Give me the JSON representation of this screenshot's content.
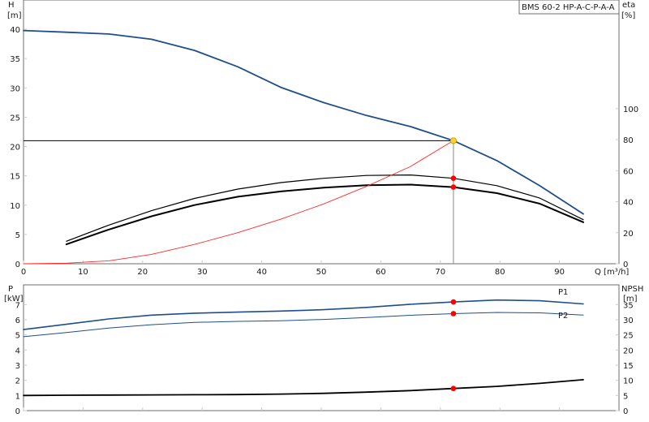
{
  "model_label": "BMS 60-2 HP-A-C-P-A-A",
  "colors": {
    "h_curve": "#1f4e8c",
    "p_curves": "#1f4e8c",
    "eta_curves": "#000000",
    "system_curve": "#ff2a2a",
    "duty_point": "#ffd42a",
    "markers": "#ff0000",
    "duty_line": "#000000",
    "duty_vertical": "#888888"
  },
  "chart_data": [
    {
      "id": "head_efficiency",
      "type": "line",
      "xlabel": "Q [m³/h]",
      "ylabel_left_name": "H",
      "ylabel_left_unit": "[m]",
      "ylabel_right_name": "eta",
      "ylabel_right_unit": "[%]",
      "xlim": [
        0,
        100
      ],
      "ylim_left": [
        0,
        45
      ],
      "ylim_right": [
        0,
        170
      ],
      "xticks": [
        0,
        10,
        20,
        30,
        40,
        50,
        60,
        70,
        80,
        90
      ],
      "yticks_left": [
        0,
        5,
        10,
        15,
        20,
        25,
        30,
        35,
        40
      ],
      "yticks_right": [
        0,
        20,
        40,
        60,
        80,
        100
      ],
      "grid": false,
      "series": [
        {
          "key": "H",
          "axis": "left",
          "color": "#1f4e8c",
          "width": 1.8,
          "points": [
            [
              0,
              39.8
            ],
            [
              7.2,
              39.5
            ],
            [
              14.3,
              39.2
            ],
            [
              21.5,
              38.3
            ],
            [
              28.7,
              36.4
            ],
            [
              36,
              33.6
            ],
            [
              43.2,
              30.1
            ],
            [
              50.4,
              27.5
            ],
            [
              57.6,
              25.3
            ],
            [
              65,
              23.4
            ],
            [
              72.2,
              21.0
            ],
            [
              79.5,
              17.6
            ],
            [
              86.7,
              13.3
            ],
            [
              94,
              8.5
            ]
          ]
        },
        {
          "key": "eta_upper",
          "axis": "right",
          "color": "#000000",
          "width": 1.2,
          "points": [
            [
              7.2,
              14.5
            ],
            [
              14.3,
              24.9
            ],
            [
              21.5,
              34.2
            ],
            [
              28.7,
              42.1
            ],
            [
              36,
              48.1
            ],
            [
              43.2,
              52.3
            ],
            [
              50.4,
              55.1
            ],
            [
              57.6,
              56.9
            ],
            [
              65,
              57.2
            ],
            [
              72.2,
              55.1
            ],
            [
              79.5,
              50.3
            ],
            [
              86.7,
              42.3
            ],
            [
              94,
              28.4
            ]
          ]
        },
        {
          "key": "eta_lower",
          "axis": "right",
          "color": "#000000",
          "width": 2,
          "points": [
            [
              7.2,
              12.5
            ],
            [
              14.3,
              22.0
            ],
            [
              21.5,
              30.6
            ],
            [
              28.7,
              37.8
            ],
            [
              36,
              43.2
            ],
            [
              43.2,
              46.6
            ],
            [
              50.4,
              49.0
            ],
            [
              57.6,
              50.6
            ],
            [
              65,
              51.0
            ],
            [
              72.2,
              49.4
            ],
            [
              79.5,
              45.5
            ],
            [
              86.7,
              38.7
            ],
            [
              94,
              26.8
            ]
          ]
        },
        {
          "key": "system_curve",
          "axis": "left",
          "color": "#ff2a2a",
          "width": 0.9,
          "points": [
            [
              0,
              0
            ],
            [
              7.2,
              0.1
            ],
            [
              14.3,
              0.5
            ],
            [
              21.5,
              1.6
            ],
            [
              28.7,
              3.3
            ],
            [
              36,
              5.3
            ],
            [
              43.2,
              7.6
            ],
            [
              50.4,
              10.2
            ],
            [
              57.6,
              13.2
            ],
            [
              65,
              16.6
            ],
            [
              72.2,
              21.0
            ]
          ]
        }
      ],
      "duty_point": [
        72.2,
        21.0
      ],
      "marker_points": [
        {
          "x": 72.2,
          "y": 55.1,
          "axis": "right"
        },
        {
          "x": 72.2,
          "y": 49.4,
          "axis": "right"
        }
      ]
    },
    {
      "id": "power_npsh",
      "type": "line",
      "ylabel_left_name": "P",
      "ylabel_left_unit": "[kW]",
      "ylabel_right_name": "NPSH",
      "ylabel_right_unit": "[m]",
      "xlim": [
        0,
        100
      ],
      "ylim_left": [
        0,
        8.3
      ],
      "ylim_right": [
        0,
        41.5
      ],
      "yticks_left": [
        0,
        1,
        2,
        3,
        4,
        5,
        6,
        7
      ],
      "yticks_right": [
        0,
        5,
        10,
        15,
        20,
        25,
        30,
        35
      ],
      "grid": false,
      "series": [
        {
          "key": "P1",
          "name": "P1",
          "axis": "left",
          "color": "#1f4e8c",
          "width": 1.6,
          "points": [
            [
              0,
              5.35
            ],
            [
              7.2,
              5.7
            ],
            [
              14.3,
              6.05
            ],
            [
              21.5,
              6.3
            ],
            [
              28.7,
              6.43
            ],
            [
              36,
              6.5
            ],
            [
              43.2,
              6.57
            ],
            [
              50.4,
              6.66
            ],
            [
              57.6,
              6.81
            ],
            [
              65,
              7.02
            ],
            [
              72.2,
              7.17
            ],
            [
              79.5,
              7.3
            ],
            [
              86.7,
              7.25
            ],
            [
              94,
              7.04
            ]
          ]
        },
        {
          "key": "P2",
          "name": "P2",
          "axis": "left",
          "color": "#1f4e8c",
          "width": 1,
          "points": [
            [
              0,
              4.88
            ],
            [
              7.2,
              5.15
            ],
            [
              14.3,
              5.45
            ],
            [
              21.5,
              5.67
            ],
            [
              28.7,
              5.82
            ],
            [
              36,
              5.89
            ],
            [
              43.2,
              5.93
            ],
            [
              50.4,
              6.02
            ],
            [
              57.6,
              6.14
            ],
            [
              65,
              6.29
            ],
            [
              72.2,
              6.4
            ],
            [
              79.5,
              6.48
            ],
            [
              86.7,
              6.45
            ],
            [
              94,
              6.3
            ]
          ]
        },
        {
          "key": "NPSH",
          "axis": "right",
          "color": "#000000",
          "width": 1.8,
          "points": [
            [
              0,
              5.0
            ],
            [
              7.2,
              5.1
            ],
            [
              14.3,
              5.15
            ],
            [
              21.5,
              5.2
            ],
            [
              28.7,
              5.25
            ],
            [
              36,
              5.3
            ],
            [
              43.2,
              5.45
            ],
            [
              50.4,
              5.7
            ],
            [
              57.6,
              6.1
            ],
            [
              65,
              6.6
            ],
            [
              72.2,
              7.3
            ],
            [
              79.5,
              8.0
            ],
            [
              86.7,
              9.0
            ],
            [
              94,
              10.2
            ]
          ]
        }
      ],
      "marker_points": [
        {
          "x": 72.2,
          "y": 7.17,
          "axis": "left"
        },
        {
          "x": 72.2,
          "y": 6.4,
          "axis": "left"
        },
        {
          "x": 72.2,
          "y": 7.3,
          "axis": "right"
        }
      ]
    }
  ]
}
